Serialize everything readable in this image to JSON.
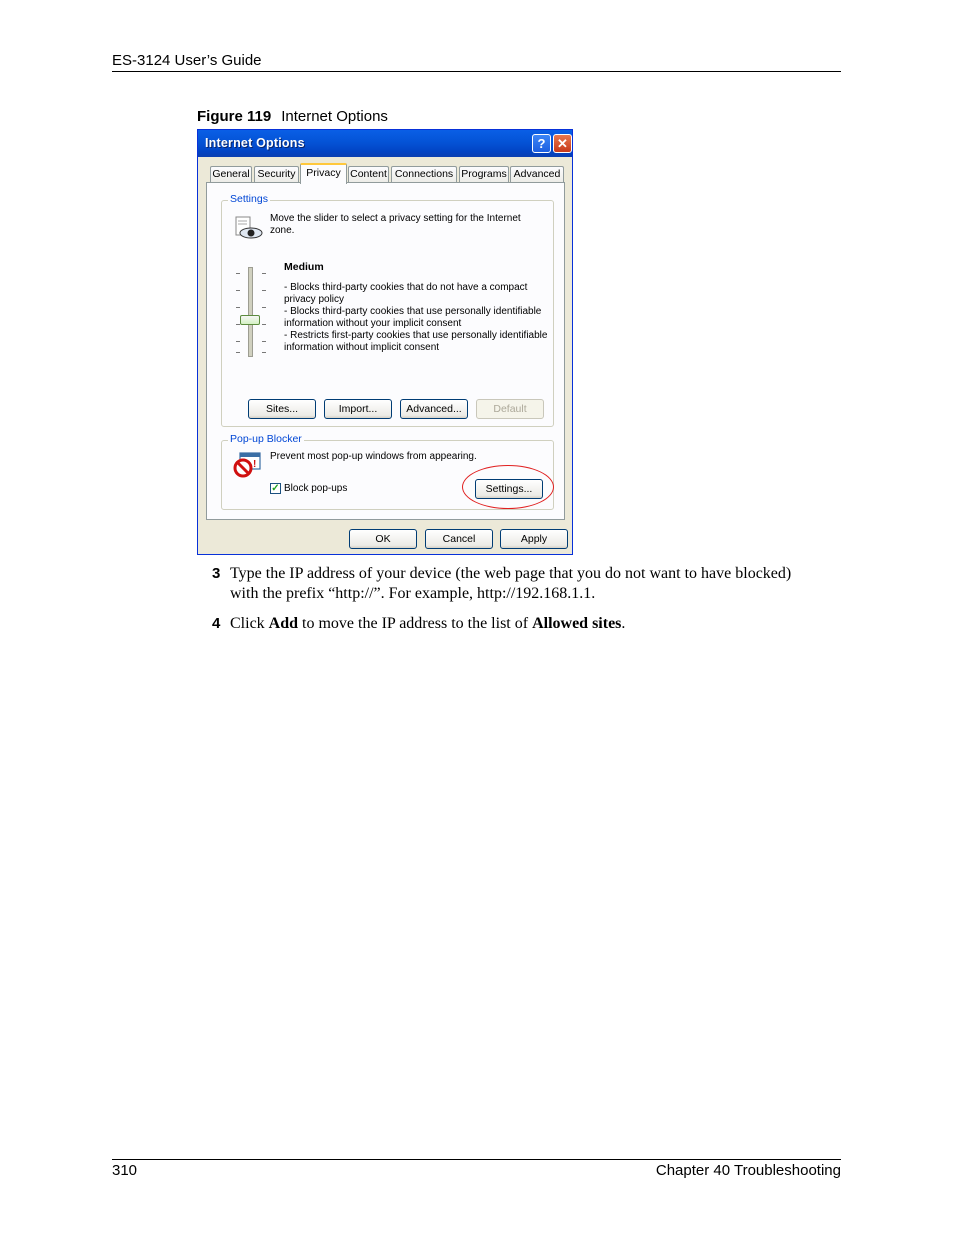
{
  "page": {
    "header": "ES-3124 User’s Guide",
    "footer_left": "310",
    "footer_right": "Chapter 40 Troubleshooting"
  },
  "figure": {
    "label": "Figure 119",
    "title": "Internet Options"
  },
  "dialog": {
    "title": "Internet Options",
    "help_glyph": "?",
    "close_glyph": "✕",
    "tabs": [
      "General",
      "Security",
      "Privacy",
      "Content",
      "Connections",
      "Programs",
      "Advanced"
    ],
    "active_tab": "Privacy",
    "settings": {
      "legend": "Settings",
      "intro_line1": "Move the slider to select a privacy setting for the Internet",
      "intro_line2": "zone.",
      "level_title": "Medium",
      "desc_lines": [
        "- Blocks third-party cookies that do not have a compact",
        "privacy policy",
        "- Blocks third-party cookies that use personally identifiable",
        "information without your implicit consent",
        "- Restricts first-party cookies that use personally identifiable",
        "information without implicit consent"
      ],
      "buttons": {
        "sites": "Sites...",
        "import": "Import...",
        "advanced": "Advanced...",
        "default": "Default"
      }
    },
    "popup": {
      "legend": "Pop-up Blocker",
      "text": "Prevent most pop-up windows from appearing.",
      "checkbox_label": "Block pop-ups",
      "checkbox_checked": true,
      "check_glyph": "✓",
      "settings_button": "Settings..."
    },
    "footer_buttons": {
      "ok": "OK",
      "cancel": "Cancel",
      "apply": "Apply"
    }
  },
  "steps": [
    {
      "num": "3",
      "text_line1": "Type the IP address of your device (the web page that you do not want to have blocked)",
      "text_line2": "with the prefix “http://”. For example, http://192.168.1.1."
    },
    {
      "num": "4",
      "pre": "Click ",
      "bold1": "Add",
      "mid": " to move the IP address to the list of ",
      "bold2": "Allowed sites",
      "post": "."
    }
  ]
}
